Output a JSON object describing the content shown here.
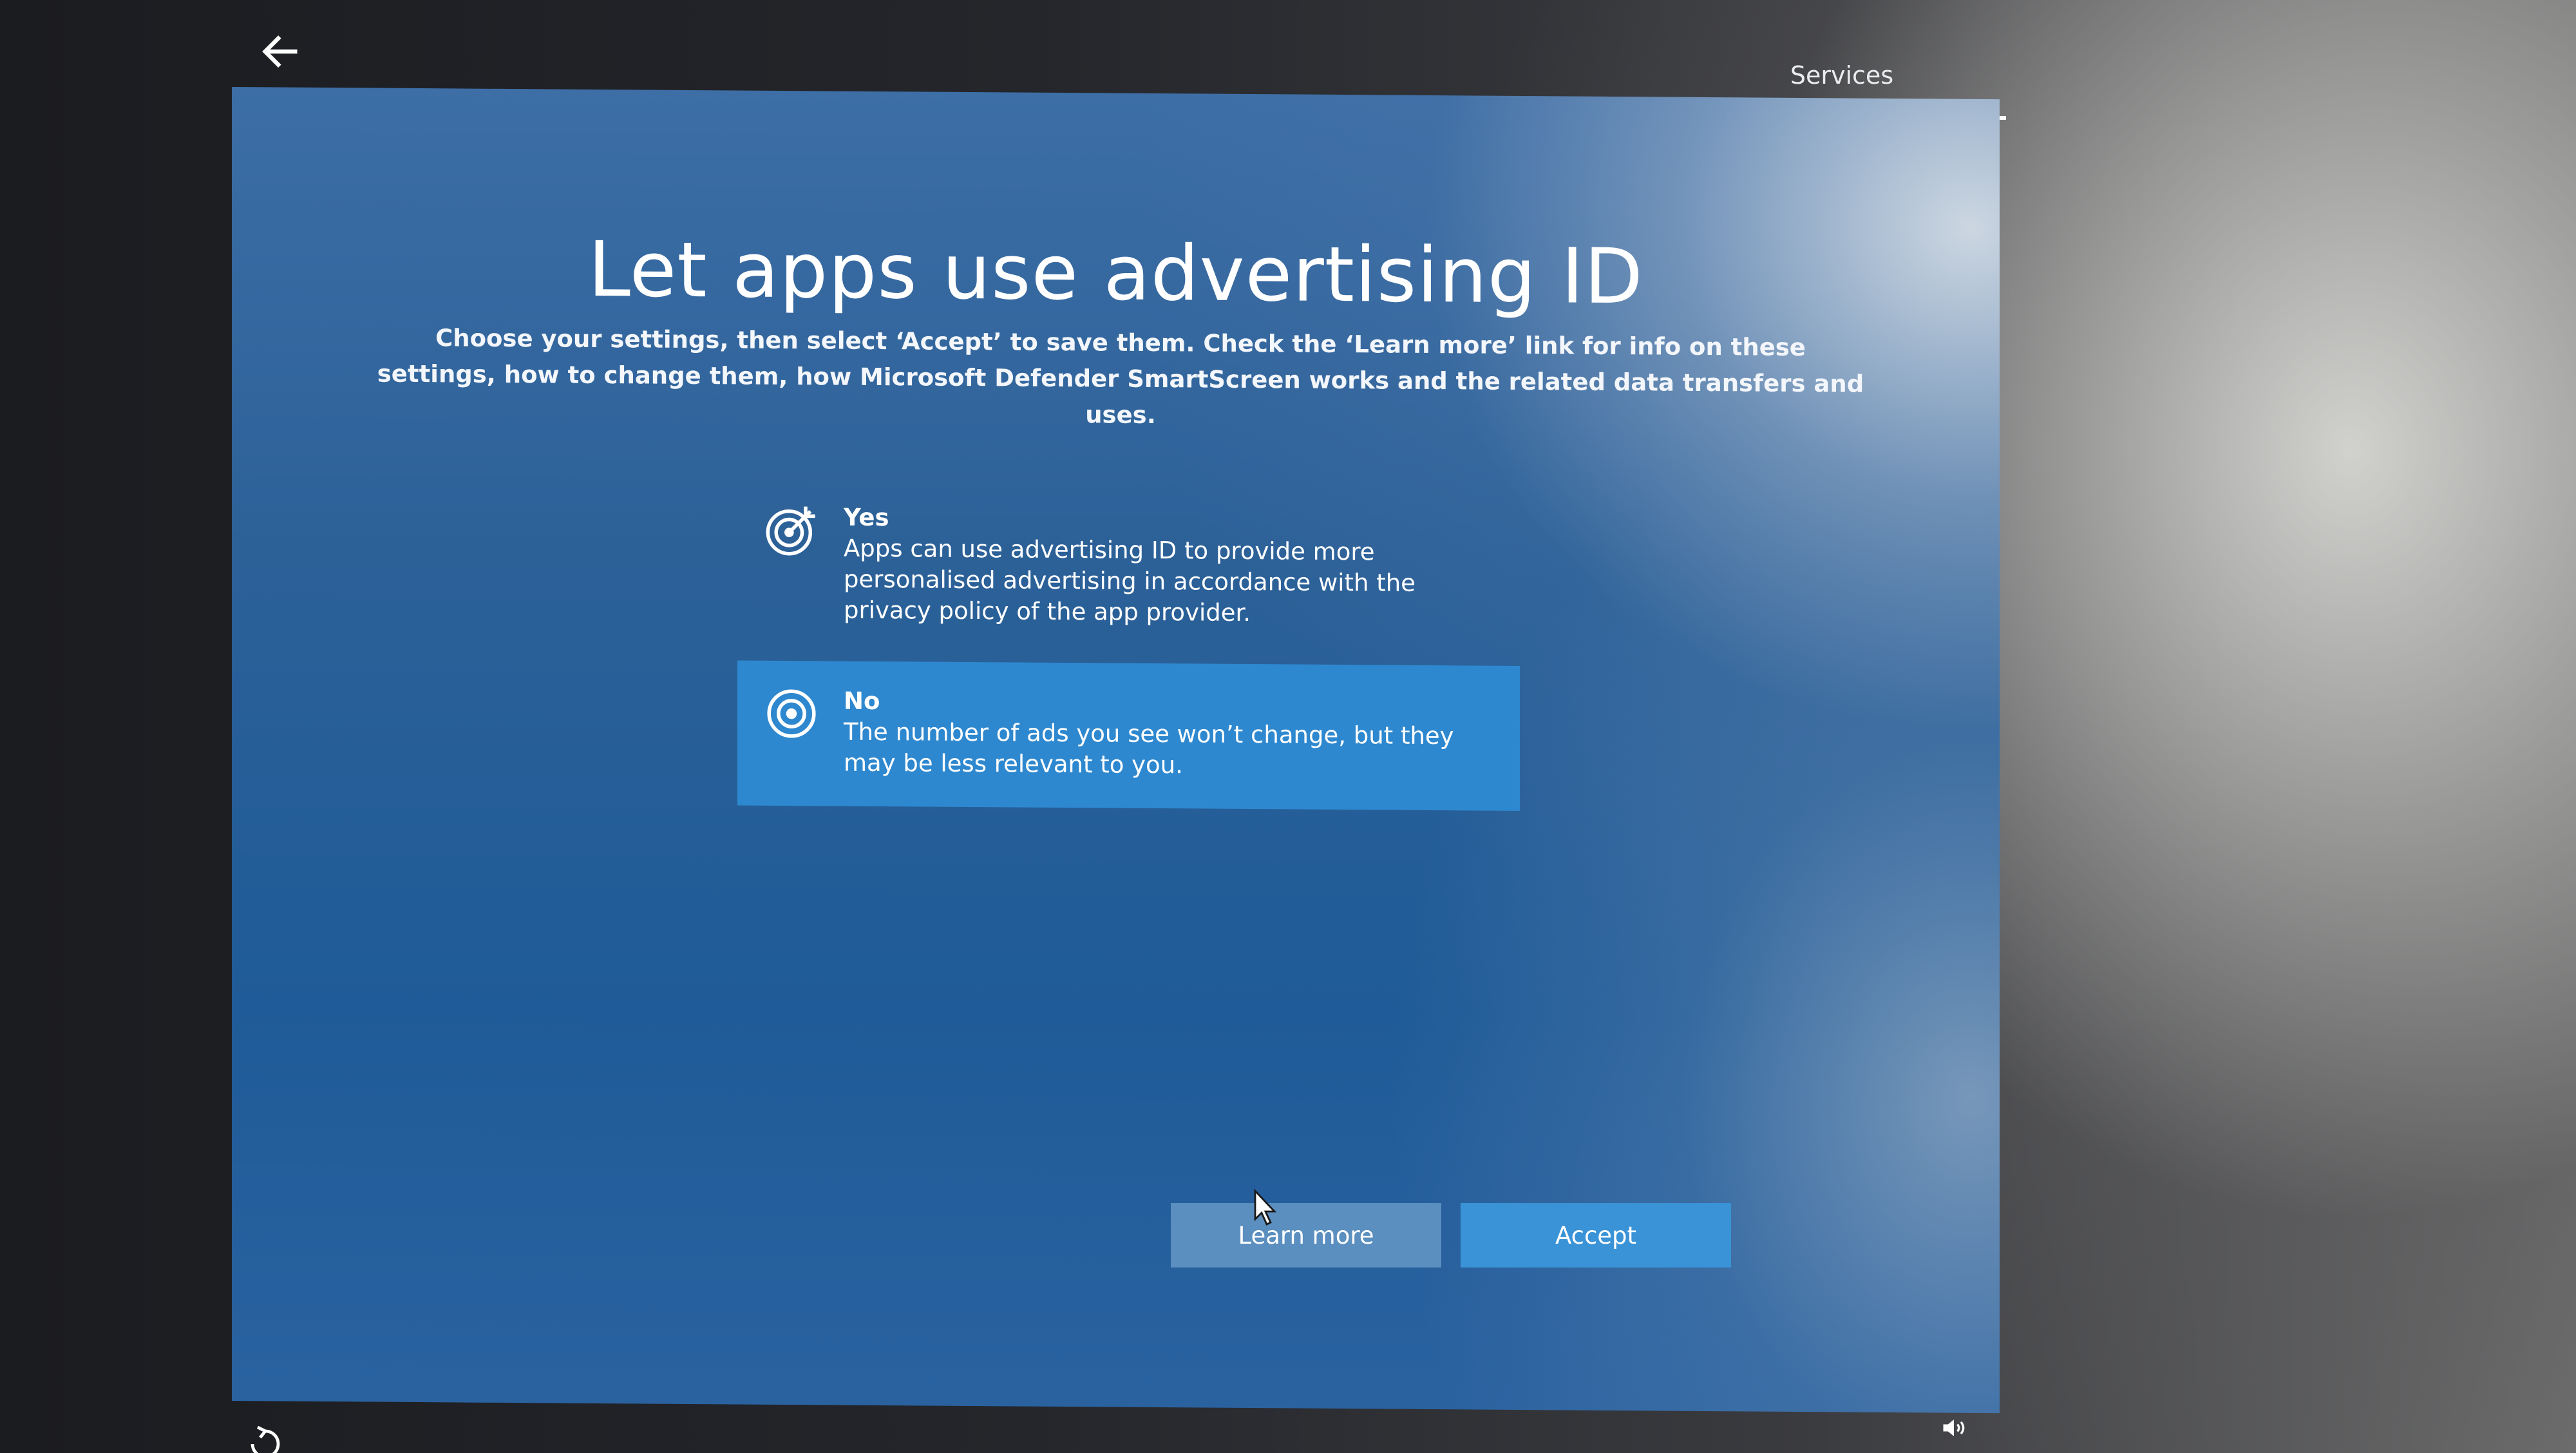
{
  "header": {
    "progress_tab_label": "Services"
  },
  "main": {
    "title": "Let apps use advertising ID",
    "subtitle": "Choose your settings, then select ‘Accept’ to save them. Check the ‘Learn more’ link for info on these settings, how to change them, how Microsoft Defender SmartScreen works and the related data transfers and uses.",
    "options": [
      {
        "label": "Yes",
        "description": "Apps can use advertising ID to provide more personalised advertising in accordance with the privacy policy of the app provider.",
        "icon": "target-arrow-icon",
        "selected": false
      },
      {
        "label": "No",
        "description": "The number of ads you see won’t change, but they may be less relevant to you.",
        "icon": "target-icon",
        "selected": true
      }
    ]
  },
  "buttons": {
    "learn_more": "Learn more",
    "accept": "Accept"
  },
  "colors": {
    "panel_blue": "#2c6198",
    "selected_option": "#2e88cf",
    "accept_button": "#3a93d6",
    "learn_more_button": "#5b8fbf"
  },
  "icons": {
    "back": "back-arrow-icon",
    "ease_of_access": "ease-of-access-icon",
    "volume": "volume-icon"
  }
}
